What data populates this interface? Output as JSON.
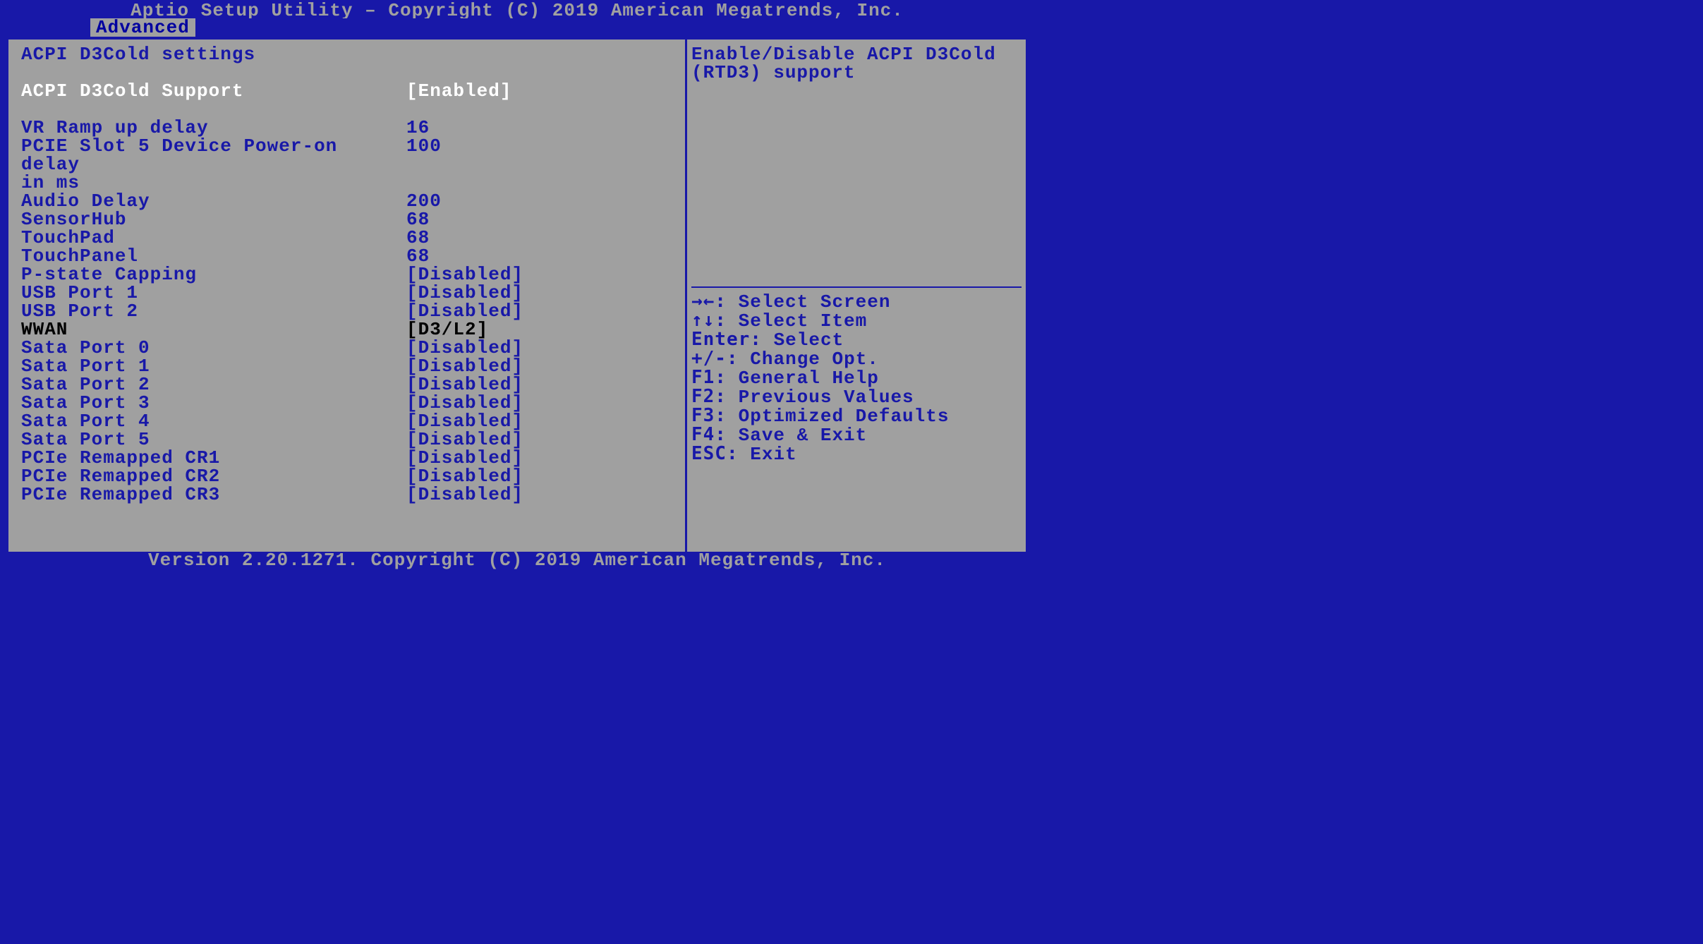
{
  "header": {
    "title": "Aptio Setup Utility – Copyright (C) 2019 American Megatrends, Inc."
  },
  "tab": {
    "label": "Advanced"
  },
  "section": {
    "title": "ACPI D3Cold settings"
  },
  "items": [
    {
      "label": "ACPI D3Cold Support",
      "value": "[Enabled]",
      "selected": true
    },
    {
      "label": "",
      "value": "",
      "spacer": true
    },
    {
      "label": "VR Ramp up delay",
      "value": "16"
    },
    {
      "label": "PCIE Slot 5 Device Power-on delay in ms",
      "value": "100",
      "wrap": true
    },
    {
      "label": "Audio Delay",
      "value": "200"
    },
    {
      "label": "SensorHub",
      "value": "68"
    },
    {
      "label": "TouchPad",
      "value": "68"
    },
    {
      "label": "TouchPanel",
      "value": "68"
    },
    {
      "label": "P-state Capping",
      "value": "[Disabled]"
    },
    {
      "label": "USB Port 1",
      "value": "[Disabled]"
    },
    {
      "label": "USB Port 2",
      "value": "[Disabled]"
    },
    {
      "label": "WWAN",
      "value": "[D3/L2]",
      "dark": true
    },
    {
      "label": "Sata Port 0",
      "value": "[Disabled]"
    },
    {
      "label": "Sata Port 1",
      "value": "[Disabled]"
    },
    {
      "label": "Sata Port 2",
      "value": "[Disabled]"
    },
    {
      "label": "Sata Port 3",
      "value": "[Disabled]"
    },
    {
      "label": "Sata Port 4",
      "value": "[Disabled]"
    },
    {
      "label": "Sata Port 5",
      "value": "[Disabled]"
    },
    {
      "label": "PCIe Remapped CR1",
      "value": "[Disabled]"
    },
    {
      "label": "PCIe Remapped CR2",
      "value": "[Disabled]"
    },
    {
      "label": "PCIe Remapped CR3",
      "value": "[Disabled]"
    }
  ],
  "help": {
    "line1": "Enable/Disable ACPI D3Cold",
    "line2": "(RTD3) support"
  },
  "keys": [
    {
      "glyph": "→←: ",
      "text": "Select Screen"
    },
    {
      "glyph": "↑↓: ",
      "text": "Select Item"
    },
    {
      "glyph": "Enter: ",
      "text": "Select"
    },
    {
      "glyph": "+/-: ",
      "text": "Change Opt."
    },
    {
      "glyph": "F1: ",
      "text": "General Help"
    },
    {
      "glyph": "F2: ",
      "text": "Previous Values"
    },
    {
      "glyph": "F3: ",
      "text": "Optimized Defaults"
    },
    {
      "glyph": "F4: ",
      "text": "Save & Exit"
    },
    {
      "glyph": "ESC: ",
      "text": "Exit"
    }
  ],
  "footer": {
    "text": "Version 2.20.1271. Copyright (C) 2019 American Megatrends, Inc."
  }
}
